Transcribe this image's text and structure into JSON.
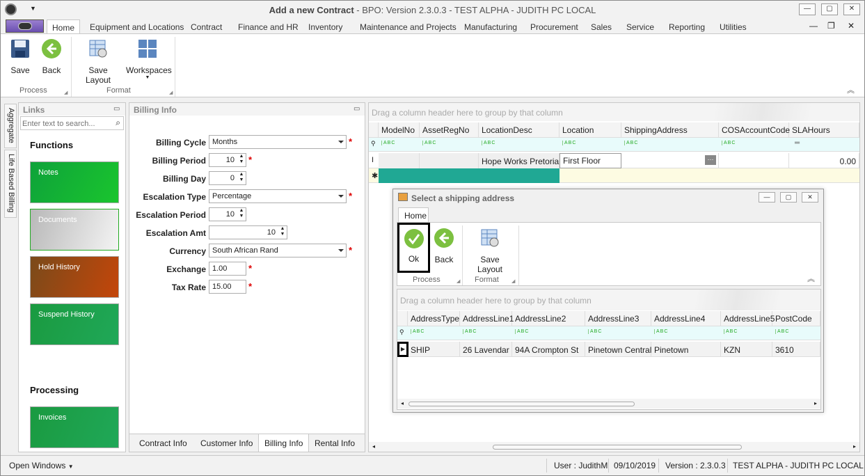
{
  "window": {
    "title_bold": "Add a new Contract",
    "title_rest": " - BPO: Version 2.3.0.3 - TEST ALPHA - JUDITH PC LOCAL"
  },
  "menu_tabs": [
    "Home",
    "Equipment and Locations",
    "Contract",
    "Finance and HR",
    "Inventory",
    "Maintenance and Projects",
    "Manufacturing",
    "Procurement",
    "Sales",
    "Service",
    "Reporting",
    "Utilities"
  ],
  "ribbon": {
    "save": "Save",
    "back": "Back",
    "save_layout": "Save Layout",
    "workspaces": "Workspaces",
    "group_process": "Process",
    "group_format": "Format"
  },
  "side_tabs": {
    "aggregate": "Aggregate",
    "life_based": "Life Based Billing"
  },
  "links": {
    "title": "Links",
    "search_placeholder": "Enter text to search...",
    "functions": "Functions",
    "processing": "Processing",
    "tiles": [
      "Notes",
      "Documents",
      "Hold History",
      "Suspend History"
    ],
    "invoices": "Invoices"
  },
  "billing": {
    "title": "Billing Info",
    "fields": {
      "billing_cycle": {
        "label": "Billing Cycle",
        "value": "Months"
      },
      "billing_period": {
        "label": "Billing Period",
        "value": "10"
      },
      "billing_day": {
        "label": "Billing Day",
        "value": "0"
      },
      "escalation_type": {
        "label": "Escalation Type",
        "value": "Percentage"
      },
      "escalation_period": {
        "label": "Escalation Period",
        "value": "10"
      },
      "escalation_amt": {
        "label": "Escalation Amt",
        "value": "10"
      },
      "currency": {
        "label": "Currency",
        "value": "South African Rand"
      },
      "exchange": {
        "label": "Exchange",
        "value": "1.00"
      },
      "tax_rate": {
        "label": "Tax Rate",
        "value": "15.00"
      }
    },
    "required_mark": "*",
    "tabs": [
      "Contract Info",
      "Customer Info",
      "Billing Info",
      "Rental Info"
    ]
  },
  "main_grid": {
    "group_hint": "Drag a column header here to group by that column",
    "columns": [
      "ModelNo",
      "AssetRegNo",
      "LocationDesc",
      "Location",
      "ShippingAddress",
      "COSAccountCode",
      "SLAHours"
    ],
    "row": {
      "location_desc": "Hope Works Pretoria",
      "location": "First Floor",
      "sla_hours": "0.00"
    }
  },
  "dialog": {
    "title": "Select a shipping address",
    "tab": "Home",
    "ok": "Ok",
    "back": "Back",
    "save_layout": "Save Layout",
    "group_process": "Process",
    "group_format": "Format",
    "group_hint": "Drag a column header here to group by that column",
    "columns": [
      "AddressType",
      "AddressLine1",
      "AddressLine2",
      "AddressLine3",
      "AddressLine4",
      "AddressLine5",
      "PostCode"
    ],
    "row": [
      "SHIP",
      "26 Lavendar",
      "94A Crompton St",
      "Pinetown Central",
      "Pinetown",
      "KZN",
      "3610"
    ]
  },
  "status": {
    "open_windows": "Open Windows",
    "user": "User : JudithM",
    "date": "09/10/2019",
    "version": "Version : 2.3.0.3",
    "env": "TEST ALPHA - JUDITH PC LOCAL"
  },
  "colors": {
    "tile_green": "#1aa84a",
    "tile_brown": "#a4461a",
    "accent_teal": "#20a894"
  }
}
